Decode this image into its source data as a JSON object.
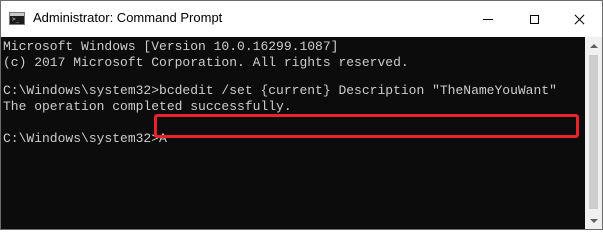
{
  "window": {
    "title": "Administrator: Command Prompt",
    "icon": "command-prompt-icon",
    "icon_prompt_glyph": ">_"
  },
  "console": {
    "lines": [
      "Microsoft Windows [Version 10.0.16299.1087]",
      "(c) 2017 Microsoft Corporation. All rights reserved.",
      "C:\\Windows\\system32>bcdedit /set {current} Description \"TheNameYouWant\"",
      "The operation completed successfully.",
      "C:\\Windows\\system32>A"
    ],
    "text_color": "#cccccc",
    "background_color": "#0c0c0c",
    "highlight_color": "#e8232b"
  }
}
